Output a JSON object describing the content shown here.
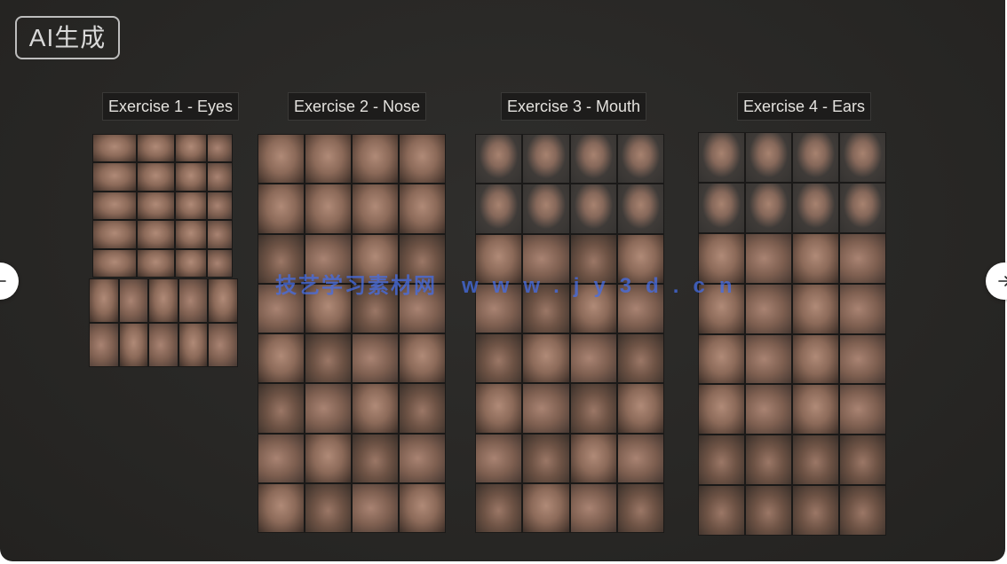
{
  "badge": {
    "text": "AI生成"
  },
  "exercises": [
    {
      "title": "Exercise 1 - Eyes"
    },
    {
      "title": "Exercise 2 - Nose"
    },
    {
      "title": "Exercise 3 - Mouth"
    },
    {
      "title": "Exercise 4 - Ears"
    }
  ],
  "watermark": {
    "cn": "技艺学习素材网",
    "url": "www.jy3d.cn"
  },
  "nav": {
    "prev_icon": "arrow-left-icon",
    "next_icon": "arrow-right-icon"
  }
}
